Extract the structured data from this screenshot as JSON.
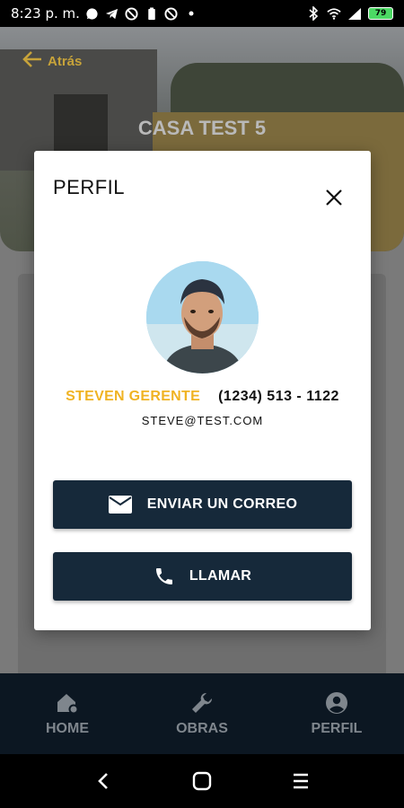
{
  "status_bar": {
    "time": "8:23 p. m.",
    "battery": "79"
  },
  "header": {
    "back_label": "Atrás",
    "title": "CASA TEST 5"
  },
  "profile_modal": {
    "title": "PERFIL",
    "name": "STEVEN GERENTE",
    "phone": "(1234) 513 - 1122",
    "email": "STEVE@TEST.COM",
    "email_button_label": "ENVIAR UN CORREO",
    "call_button_label": "LLAMAR"
  },
  "bottom_nav": {
    "items": [
      {
        "label": "HOME",
        "icon": "home-gear-icon"
      },
      {
        "label": "OBRAS",
        "icon": "wrench-icon"
      },
      {
        "label": "PERFIL",
        "icon": "account-circle-icon"
      }
    ]
  },
  "colors": {
    "accent": "#f0b323",
    "button_bg": "#16293a",
    "nav_bg": "#0c1722"
  }
}
